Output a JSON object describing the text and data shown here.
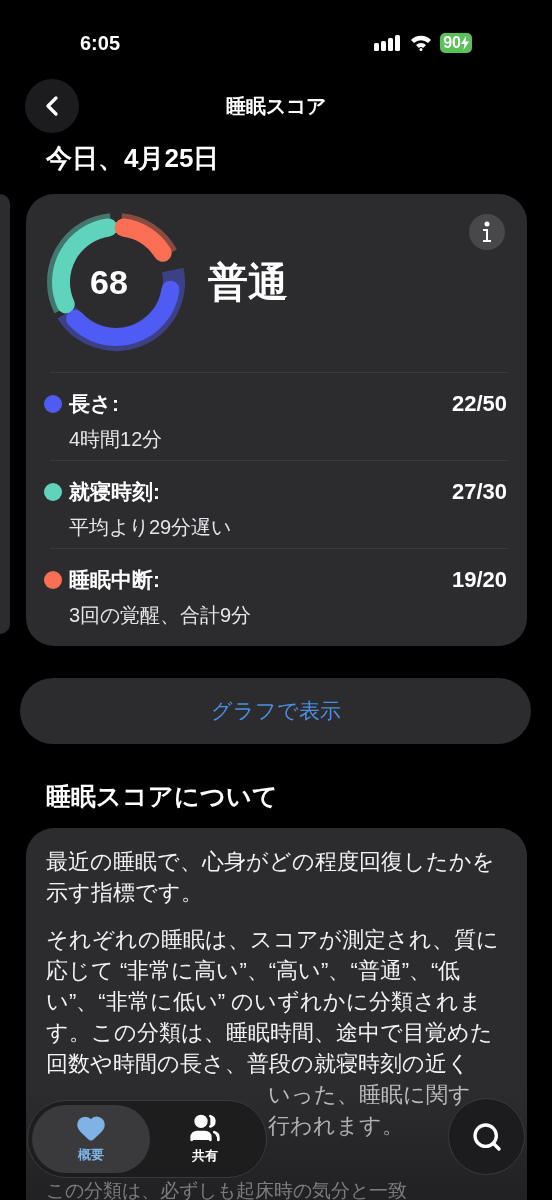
{
  "status_bar": {
    "time": "6:05",
    "battery": "90"
  },
  "nav": {
    "title": "睡眠スコア"
  },
  "date": "今日、4月25日",
  "score_card": {
    "score": "68",
    "rating": "普通",
    "metrics": [
      {
        "label": "長さ:",
        "detail": "4時間12分",
        "points": "22/50",
        "color": "#4f5bf5"
      },
      {
        "label": "就寝時刻:",
        "detail": "平均より29分遅い",
        "points": "27/30",
        "color": "#5fd3bc"
      },
      {
        "label": "睡眠中断:",
        "detail": "3回の覚醒、合計9分",
        "points": "19/20",
        "color": "#fd6f55"
      }
    ]
  },
  "graph_button": "グラフで表示",
  "about": {
    "heading": "睡眠スコアについて",
    "paragraphs": [
      "最近の睡眠で、心身がどの程度回復したかを示す指標です。",
      "それぞれの睡眠は、スコアが測定され、質に応じて “非常に高い”、“高い”、“普通”、“低い”、“非常に低い” のいずれかに分類されます。この分類は、睡眠時間、途中で目覚めた回数や時間の長さ、普段の就寝時刻の近く"
    ],
    "partial_lines": [
      "いった、睡眠に関す",
      "行われます。"
    ],
    "faded_line": "この分類は、必ずしも起床時の気分と一致"
  },
  "tab_bar": {
    "tabs": [
      {
        "label": "概要",
        "selected": true,
        "kind": "heart"
      },
      {
        "label": "共有",
        "selected": false,
        "kind": "people"
      }
    ]
  }
}
